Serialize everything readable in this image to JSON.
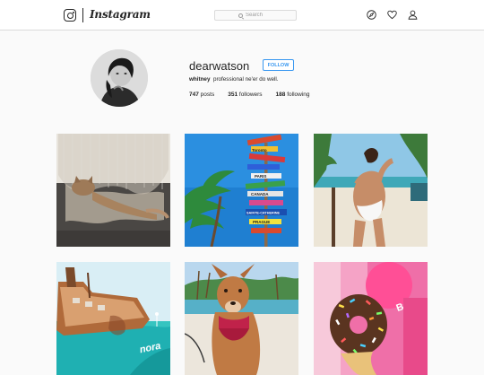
{
  "header": {
    "logo_text": "Instagram",
    "search_placeholder": "Search",
    "icons": [
      "explore-compass-icon",
      "activity-heart-icon",
      "profile-person-icon"
    ]
  },
  "profile": {
    "username": "dearwatson",
    "follow_label": "FOLLOW",
    "display_name": "whitney",
    "bio": "professional ne'er do well.",
    "posts": "747",
    "posts_label": "posts",
    "followers": "351",
    "followers_label": "followers",
    "following": "188",
    "following_label": "following"
  },
  "posts_grid": [
    {
      "subject": "cat on floor under lace curtain"
    },
    {
      "subject": "signpost with destination signs under palm tree",
      "signs": [
        "Toronto",
        "PARIS",
        "CANADA",
        "SAINTE-CATHERINE",
        "PRAGUE"
      ]
    },
    {
      "subject": "woman in swimsuit on beach"
    },
    {
      "subject": "rusted shipwreck with turquoise water",
      "caption": "nora"
    },
    {
      "subject": "dog on beach"
    },
    {
      "subject": "sprinkle covered donut in front of pink sign",
      "sign_text": "BAR"
    }
  ],
  "colors": {
    "accent": "#3897f0",
    "border": "#dbdbdb",
    "background": "#fafafa"
  }
}
